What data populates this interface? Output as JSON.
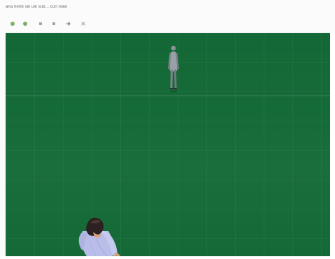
{
  "menu": {
    "text": "ana hehb sik ulk sub... curt waw"
  },
  "toolbar": {
    "icons": [
      "green-dot-icon",
      "green-dot-icon",
      "small-square-icon",
      "small-square-icon",
      "arrow-icon",
      "close-icon"
    ],
    "icon_colors": [
      "#7eb36a",
      "#7eb36a",
      "#a3a7ad",
      "#a3a7ad",
      "#7f858d",
      "#a0a3a8"
    ]
  },
  "scene": {
    "floor_color": "#156b38",
    "grid_color": "#2c7d4c",
    "background_person_clothing": "#9aa0a7",
    "foreground_person_shirt": "#b9bde8",
    "foreground_person_hair": "#2d2020",
    "skin_color": "#d7a47f"
  }
}
